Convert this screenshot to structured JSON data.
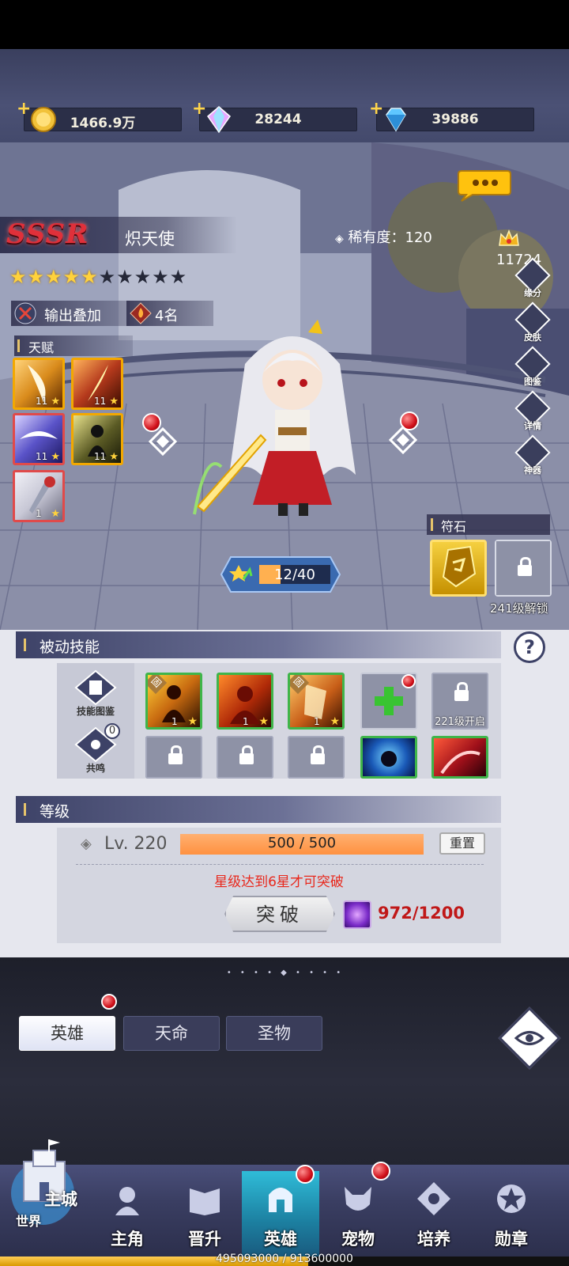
{
  "currencies": {
    "gold": "1466.9万",
    "prism": "28244",
    "diamond": "39886"
  },
  "hero": {
    "grade": "SSSR",
    "name": "炽天使",
    "rarity_label": "稀有度：",
    "rarity_value": "120",
    "power": "11724",
    "stars_total": 10,
    "stars_filled": 5,
    "tag_output": "输出叠加",
    "tag_count": "4名"
  },
  "talent": {
    "title": "天赋",
    "skills": [
      {
        "level": "11",
        "color": "#d98b1c",
        "icon": "claw-skill-icon"
      },
      {
        "level": "11",
        "color": "#b4391c",
        "icon": "flame-slash-icon"
      },
      {
        "level": "11",
        "color": "#5a53c8",
        "icon": "wind-vortex-icon"
      },
      {
        "level": "11",
        "color": "#5a5a24",
        "icon": "shadow-figure-icon"
      },
      {
        "level": "1",
        "color": "#c8c8d6",
        "icon": "rose-sword-icon"
      }
    ]
  },
  "right_menu": [
    "缘分",
    "皮肤",
    "图鉴",
    "详情",
    "神器"
  ],
  "exp_progress": "12/40",
  "runestone": {
    "title": "符石",
    "unlock_text": "241级解锁"
  },
  "passive": {
    "title": "被动技能",
    "side_buttons": [
      "技能图鉴",
      "共鸣"
    ],
    "resonance_count": "0",
    "fixed_badge": "固",
    "skills_row1_levels": [
      "1",
      "1",
      "1"
    ],
    "unlock_221": "221级开启"
  },
  "level": {
    "title": "等级",
    "label": "Lv. 220",
    "progress": "500 / 500",
    "reset": "重置",
    "hint": "星级达到6星才可突破",
    "break_label": "突破",
    "material_count": "972/1200"
  },
  "tabs": [
    {
      "label": "英雄",
      "active": true
    },
    {
      "label": "天命",
      "active": false
    },
    {
      "label": "圣物",
      "active": false
    }
  ],
  "nav": {
    "main_city_top": "主城",
    "main_city_bottom": "世界",
    "items": [
      "主角",
      "晋升",
      "英雄",
      "宠物",
      "培养",
      "勋章"
    ]
  },
  "xp_text": "495093000 / 913600000"
}
